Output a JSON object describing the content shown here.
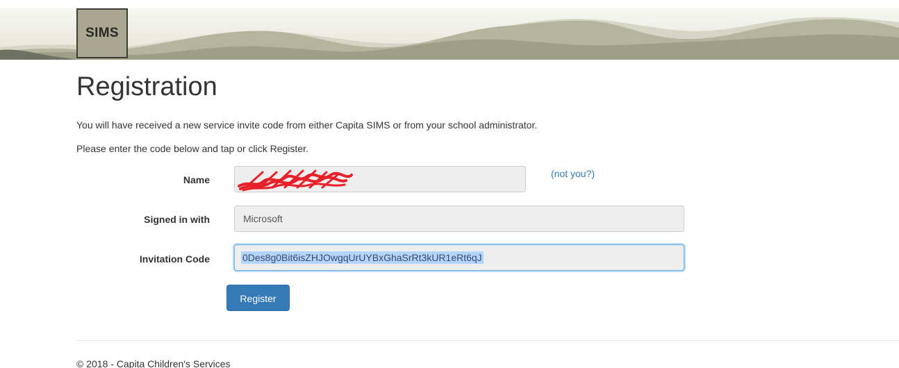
{
  "banner": {
    "logo_text": "SIMS"
  },
  "page": {
    "title": "Registration",
    "intro_1": "You will have received a new service invite code from either Capita SIMS or from your school administrator.",
    "intro_2": "Please enter the code below and tap or click Register."
  },
  "form": {
    "name_label": "Name",
    "name_value": "",
    "name_value_state": "redacted",
    "not_you_link": "(not you?)",
    "signed_in_label": "Signed in with",
    "signed_in_value": "Microsoft",
    "invitation_label": "Invitation Code",
    "invitation_value": "0Des8g0Bit6isZHJOwgqUrUYBxGhaSrRt3kUR1eRt6qJ",
    "register_button": "Register"
  },
  "footer": {
    "text": "© 2018 - Capita Children's Services"
  },
  "colors": {
    "link": "#337ab7",
    "primary_button": "#337ab7",
    "field_background": "#eeeeee",
    "focus_border": "#66afe9",
    "selection": "#b3d4fd",
    "redaction": "#e8202a",
    "logo_background": "#a9a692"
  },
  "icons": {
    "redaction": "red-scribble-redaction"
  }
}
